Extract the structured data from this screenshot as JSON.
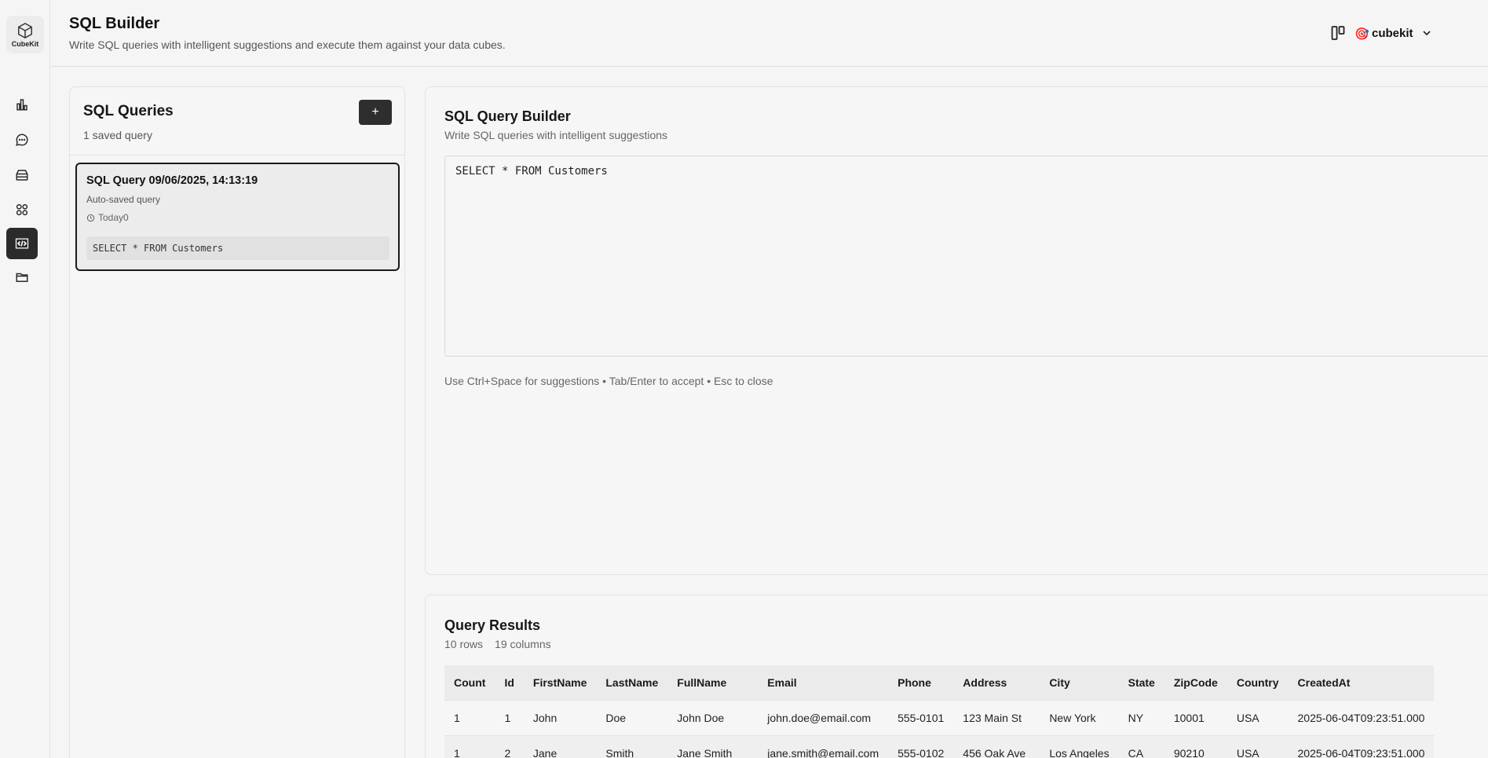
{
  "app": {
    "logo_text": "CubeKit"
  },
  "rail": {
    "items": [
      {
        "name": "bar-chart-icon",
        "active": false
      },
      {
        "name": "chat-icon",
        "active": false
      },
      {
        "name": "database-icon",
        "active": false
      },
      {
        "name": "grid-icon",
        "active": false
      },
      {
        "name": "code-icon",
        "active": true
      },
      {
        "name": "folder-icon",
        "active": false
      }
    ]
  },
  "header": {
    "title": "SQL Builder",
    "subtitle": "Write SQL queries with intelligent suggestions and execute them against your data cubes.",
    "user_emoji": "🎯",
    "user_name": "cubekit"
  },
  "queries": {
    "title": "SQL Queries",
    "count": "1 saved query",
    "add_label": "+",
    "items": [
      {
        "title": "SQL Query 09/06/2025, 14:13:19",
        "description": "Auto-saved query",
        "time": "Today0",
        "sql": "SELECT * FROM Customers"
      }
    ]
  },
  "builder": {
    "title": "SQL Query Builder",
    "subtitle": "Write SQL queries with intelligent suggestions",
    "sql": "SELECT * FROM Customers",
    "hint": "Use Ctrl+Space for suggestions • Tab/Enter to accept • Esc to close"
  },
  "results": {
    "title": "Query Results",
    "rows_label": "10 rows",
    "cols_label": "19 columns",
    "columns": [
      "Count",
      "Id",
      "FirstName",
      "LastName",
      "FullName",
      "Email",
      "Phone",
      "Address",
      "City",
      "State",
      "ZipCode",
      "Country",
      "CreatedAt"
    ],
    "rows": [
      [
        "1",
        "1",
        "John",
        "Doe",
        "John Doe",
        "john.doe@email.com",
        "555-0101",
        "123 Main St",
        "New York",
        "NY",
        "10001",
        "USA",
        "2025-06-04T09:23:51.000"
      ],
      [
        "1",
        "2",
        "Jane",
        "Smith",
        "Jane Smith",
        "jane.smith@email.com",
        "555-0102",
        "456 Oak Ave",
        "Los Angeles",
        "CA",
        "90210",
        "USA",
        "2025-06-04T09:23:51.000"
      ]
    ]
  },
  "colors": {
    "accent": "#2b2b2b",
    "background": "#f5f5f5",
    "border": "#e2e2e2"
  }
}
